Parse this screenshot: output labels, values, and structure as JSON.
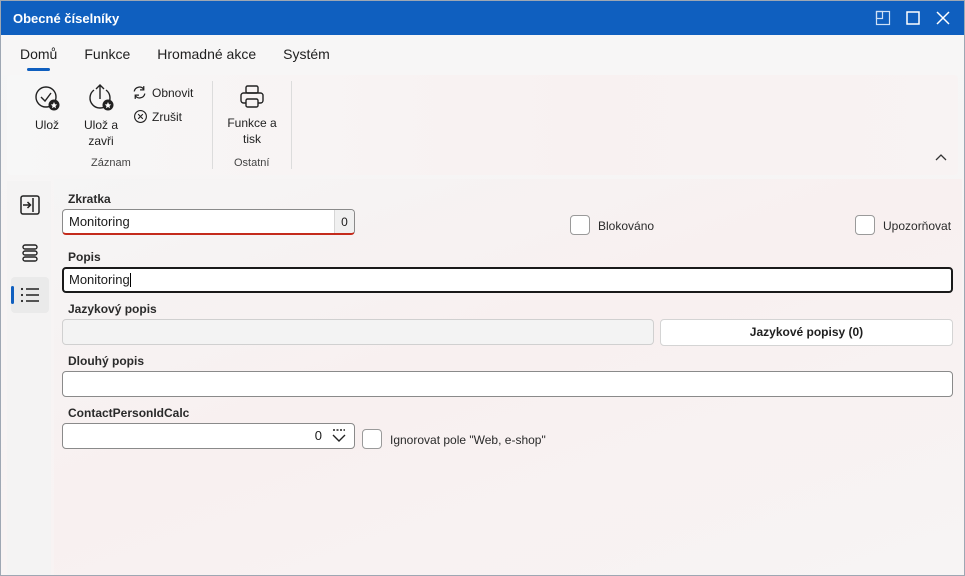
{
  "window": {
    "title": "Obecné číselníky"
  },
  "tabs": [
    {
      "label": "Domů",
      "active": true
    },
    {
      "label": "Funkce"
    },
    {
      "label": "Hromadné akce"
    },
    {
      "label": "Systém"
    }
  ],
  "ribbon": {
    "save_label": "Ulož",
    "save_close_label_line1": "Ulož a",
    "save_close_label_line2": "zavři",
    "refresh_label": "Obnovit",
    "cancel_label": "Zrušit",
    "print_label_line1": "Funkce a",
    "print_label_line2": "tisk",
    "group_record": "Záznam",
    "group_other": "Ostatní"
  },
  "form": {
    "zkratka_label": "Zkratka",
    "zkratka_value": "Monitoring",
    "zkratka_counter": "0",
    "blokovano_label": "Blokováno",
    "upozornovat_label": "Upozorňovat",
    "popis_label": "Popis",
    "popis_value": "Monitoring",
    "jazykovy_popis_label": "Jazykový popis",
    "jazykovy_popis_value": "",
    "jazykove_popisy_button": "Jazykové popisy (0)",
    "dlouhy_popis_label": "Dlouhý popis",
    "dlouhy_popis_value": "",
    "contact_label": "ContactPersonIdCalc",
    "contact_value": "0",
    "ignorovat_label": "Ignorovat pole \"Web, e-shop\""
  },
  "colors": {
    "accent": "#0f5fbf",
    "error": "#c42b1c"
  },
  "icons": {
    "save": "save-check-icon",
    "save_close": "save-close-icon",
    "refresh": "refresh-icon",
    "cancel": "cancel-icon",
    "print": "printer-icon",
    "collapse": "chevron-up-icon"
  }
}
